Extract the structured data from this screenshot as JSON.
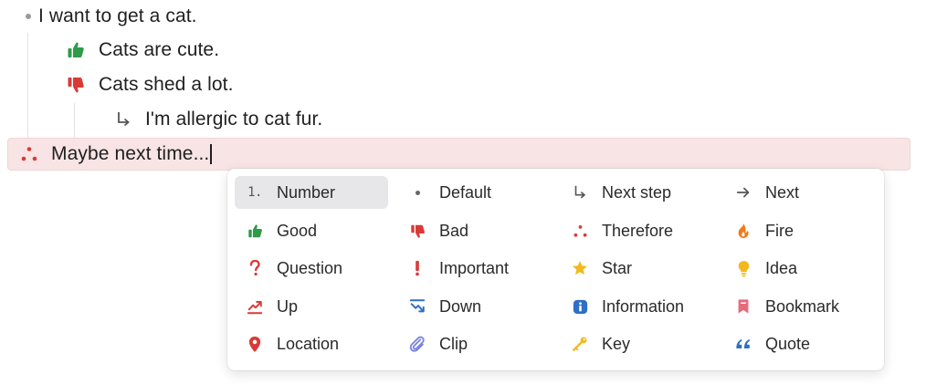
{
  "outline": {
    "rows": [
      {
        "text": "I want to get a cat.",
        "icon": "bullet-dot-icon"
      },
      {
        "text": "Cats are cute.",
        "icon": "thumbs-up-icon"
      },
      {
        "text": "Cats shed a lot.",
        "icon": "thumbs-down-icon"
      },
      {
        "text": "I'm allergic to cat fur.",
        "icon": "next-step-arrow-icon"
      },
      {
        "text": "Maybe next time...",
        "icon": "therefore-icon"
      }
    ]
  },
  "colors": {
    "green": "#2f9a48",
    "red": "#d93a37",
    "blue": "#2f6fc6",
    "yellow": "#f2b91e",
    "orange": "#f07a1a",
    "pink": "#e76a7a",
    "purple": "#7b86e0",
    "highlight": "#f8e4e4"
  },
  "menu": {
    "columns": [
      [
        {
          "label": "Number",
          "icon": "number-icon",
          "glyph": "1.",
          "selected": true
        },
        {
          "label": "Good",
          "icon": "thumbs-up-icon"
        },
        {
          "label": "Question",
          "icon": "question-icon"
        },
        {
          "label": "Up",
          "icon": "trend-up-icon"
        },
        {
          "label": "Location",
          "icon": "location-pin-icon"
        }
      ],
      [
        {
          "label": "Default",
          "icon": "bullet-dot-icon"
        },
        {
          "label": "Bad",
          "icon": "thumbs-down-icon"
        },
        {
          "label": "Important",
          "icon": "exclamation-icon"
        },
        {
          "label": "Down",
          "icon": "trend-down-icon"
        },
        {
          "label": "Clip",
          "icon": "paperclip-icon"
        }
      ],
      [
        {
          "label": "Next step",
          "icon": "next-step-arrow-icon"
        },
        {
          "label": "Therefore",
          "icon": "therefore-icon"
        },
        {
          "label": "Star",
          "icon": "star-icon"
        },
        {
          "label": "Information",
          "icon": "info-icon"
        },
        {
          "label": "Key",
          "icon": "key-icon"
        }
      ],
      [
        {
          "label": "Next",
          "icon": "right-arrow-icon"
        },
        {
          "label": "Fire",
          "icon": "fire-icon"
        },
        {
          "label": "Idea",
          "icon": "lightbulb-icon"
        },
        {
          "label": "Bookmark",
          "icon": "bookmark-icon"
        },
        {
          "label": "Quote",
          "icon": "quote-icon"
        }
      ]
    ]
  }
}
